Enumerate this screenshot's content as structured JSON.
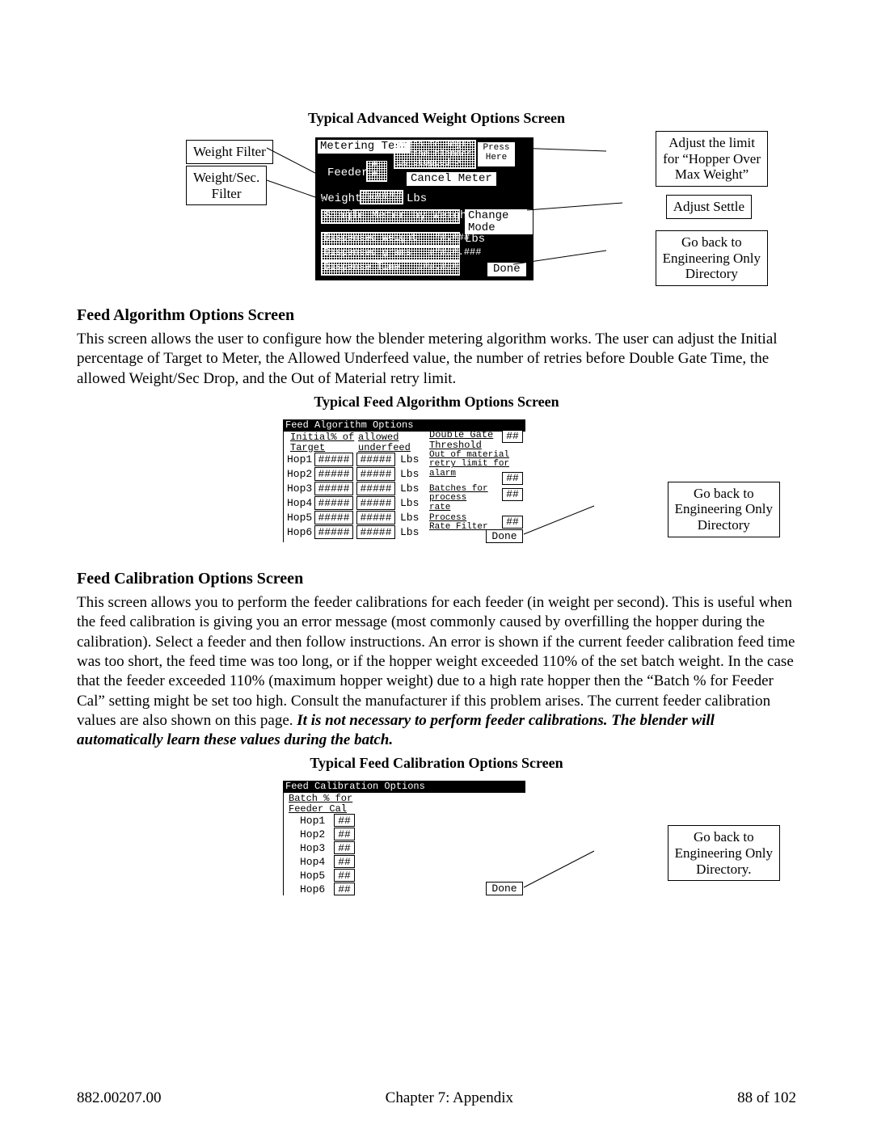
{
  "captions": {
    "fig1": "Typical Advanced Weight Options Screen",
    "fig2": "Typical Feed Algorithm Options Screen",
    "fig3": "Typical Feed Calibration Options Screen"
  },
  "headings": {
    "h2": "Feed Algorithm Options Screen",
    "h3": "Feed Calibration Options Screen"
  },
  "paras": {
    "p2": "This screen allows the user to configure how the blender metering algorithm works.  The user can adjust the Initial percentage of Target to Meter, the Allowed Underfeed value, the number of retries before Double Gate Time, the allowed Weight/Sec Drop, and the Out of Material retry limit.",
    "p3a": "This screen allows you to perform the feeder calibrations for each feeder (in weight per second).  This is useful when the feed calibration is giving you an error message (most commonly caused by overfilling the hopper during the calibration).  Select a feeder and then follow instructions.  An error is shown if the current feeder calibration feed time was too short, the feed time was too long, or if the hopper weight exceeded 110% of the set batch weight.  In the case that the feeder exceeded 110% (maximum hopper weight) due to a high rate hopper then the “Batch % for Feeder Cal” setting might be set too high.  Consult the manufacturer if this problem arises.  The current feeder calibration values are also shown on this page.  ",
    "p3b": "It is not necessary to perform feeder calibrations.  The blender will automatically learn these values during the batch."
  },
  "callouts": {
    "weight_filter": "Weight Filter",
    "weight_sec_filter": "Weight/Sec.\nFilter",
    "adjust_limit": "Adjust the limit\nfor “Hopper Over\nMax Weight”",
    "adjust_settle": "Adjust Settle",
    "go_back": "Go back to\nEngineering Only\nDirectory",
    "go_back_dot": "Go back to\nEngineering Only\nDirectory."
  },
  "screen1": {
    "title": "Metering Test",
    "press_msg": "Press to Begin\nif the blender\nis stopped->",
    "press_here": "Press\nHere",
    "feeder": "Feeder",
    "feeder_val": "#\n#",
    "cancel_meter": "Cancel Meter",
    "weight": "Weight",
    "weight_val": "######",
    "lbs": "Lbs",
    "single_meter": "Single Meter by Weight",
    "change_mode": "Change Mode",
    "disp_w": "Dispensed Weight=  ##.###",
    "disp_g": "Dispensed grams=  #####.###",
    "disp_t": "Dispense Time=  ###.###",
    "done": "Done"
  },
  "screen2": {
    "title": "Feed Algorithm Options",
    "col1": "Initial% of\nTarget",
    "col2": "allowed\nunderfeed",
    "double_gate": "Double Gate\nThreshold",
    "double_gate_val": "##",
    "out_mat": "Out of material\nretry limit for\nalarm",
    "out_mat_val": "##",
    "batches_for": "Batches for\nprocess\nrate",
    "batches_for_val": "##",
    "rate_filter": "Process\nRate Filter",
    "rate_filter_val": "##",
    "done": "Done",
    "rows": [
      {
        "hop": "Hop1",
        "c1": "#####",
        "c2": "#####",
        "unit": "Lbs"
      },
      {
        "hop": "Hop2",
        "c1": "#####",
        "c2": "#####",
        "unit": "Lbs"
      },
      {
        "hop": "Hop3",
        "c1": "#####",
        "c2": "#####",
        "unit": "Lbs"
      },
      {
        "hop": "Hop4",
        "c1": "#####",
        "c2": "#####",
        "unit": "Lbs"
      },
      {
        "hop": "Hop5",
        "c1": "#####",
        "c2": "#####",
        "unit": "Lbs"
      },
      {
        "hop": "Hop6",
        "c1": "#####",
        "c2": "#####",
        "unit": "Lbs"
      }
    ]
  },
  "screen3": {
    "title": "Feed Calibration Options",
    "col1": "Batch % for\nFeeder Cal",
    "done": "Done",
    "rows": [
      {
        "hop": "Hop1",
        "v": "##"
      },
      {
        "hop": "Hop2",
        "v": "##"
      },
      {
        "hop": "Hop3",
        "v": "##"
      },
      {
        "hop": "Hop4",
        "v": "##"
      },
      {
        "hop": "Hop5",
        "v": "##"
      },
      {
        "hop": "Hop6",
        "v": "##"
      }
    ]
  },
  "footer": {
    "left": "882.00207.00",
    "center": "Chapter 7: Appendix",
    "right": "88 of 102"
  }
}
